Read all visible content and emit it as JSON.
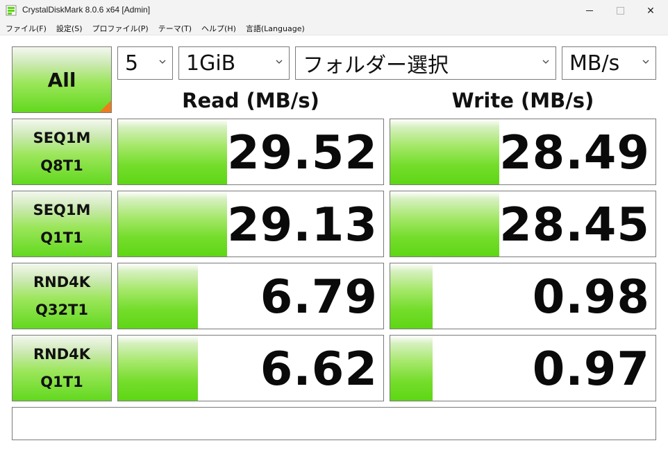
{
  "window": {
    "title": "CrystalDiskMark 8.0.6 x64 [Admin]",
    "min_glyph": "",
    "close_glyph": "✕"
  },
  "menu": [
    "ファイル(F)",
    "設定(S)",
    "プロファイル(P)",
    "テーマ(T)",
    "ヘルプ(H)",
    "言語(Language)"
  ],
  "controls": {
    "all_label": "All",
    "count": "5",
    "size": "1GiB",
    "folder": "フォルダー選択",
    "unit": "MB/s"
  },
  "headers": {
    "read": "Read (MB/s)",
    "write": "Write (MB/s)"
  },
  "tests": [
    {
      "line1": "SEQ1M",
      "line2": "Q8T1",
      "read": "29.52",
      "write": "28.49",
      "read_level": 0.41,
      "write_level": 0.41
    },
    {
      "line1": "SEQ1M",
      "line2": "Q1T1",
      "read": "29.13",
      "write": "28.45",
      "read_level": 0.41,
      "write_level": 0.41
    },
    {
      "line1": "RND4K",
      "line2": "Q32T1",
      "read": "6.79",
      "write": "0.98",
      "read_level": 0.3,
      "write_level": 0.16
    },
    {
      "line1": "RND4K",
      "line2": "Q1T1",
      "read": "6.62",
      "write": "0.97",
      "read_level": 0.3,
      "write_level": 0.16
    }
  ],
  "status_text": "",
  "colors": {
    "accent_orange": "#ec7c1d",
    "bar_green": "#5ed615"
  }
}
